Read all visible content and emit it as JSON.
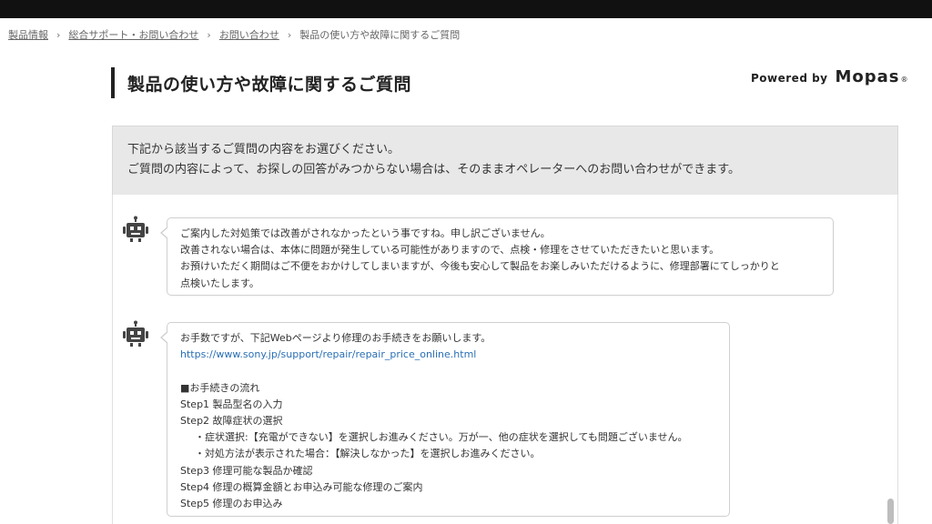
{
  "breadcrumb": {
    "items": [
      "製品情報",
      "総合サポート・お問い合わせ",
      "お問い合わせ"
    ],
    "current": "製品の使い方や故障に関するご質問",
    "separator": "›"
  },
  "page": {
    "title": "製品の使い方や故障に関するご質問",
    "powered_by": "Powered by",
    "brand": "Mopas",
    "brand_mark": "®"
  },
  "info": {
    "line1": "下記から該当するご質問の内容をお選びください。",
    "line2": "ご質問の内容によって、お探しの回答がみつからない場合は、そのままオペレーターへのお問い合わせができます。"
  },
  "chat": {
    "message1": {
      "lines": [
        "ご案内した対処策では改善がされなかったという事ですね。申し訳ございません。",
        "改善されない場合は、本体に問題が発生している可能性がありますので、点検・修理をさせていただきたいと思います。",
        "お預けいただく期間はご不便をおかけしてしまいますが、今後も安心して製品をお楽しみいただけるように、修理部署にてしっかりと",
        "点検いたします。"
      ]
    },
    "message2": {
      "intro": "お手数ですが、下記Webページより修理のお手続きをお願いします。",
      "link": "https://www.sony.jp/support/repair/repair_price_online.html",
      "flow_title": "■お手続きの流れ",
      "step1": "Step1 製品型名の入力",
      "step2": "Step2 故障症状の選択",
      "step2_note1": "・症状選択:【充電ができない】を選択しお進みください。万が一、他の症状を選択しても問題ございません。",
      "step2_note2": "・対処方法が表示された場合：【解決しなかった】を選択しお進みください。",
      "step3": "Step3 修理可能な製品か確認",
      "step4": "Step4 修理の概算金額とお申込み可能な修理のご案内",
      "step5": "Step5 修理のお申込み"
    }
  },
  "colors": {
    "topbar": "#111111",
    "title_accent": "#222222",
    "info_bg": "#e8e8e8",
    "link": "#2a6fb5",
    "bot_icon": "#444444"
  },
  "icons": {
    "bot": "robot-icon"
  }
}
